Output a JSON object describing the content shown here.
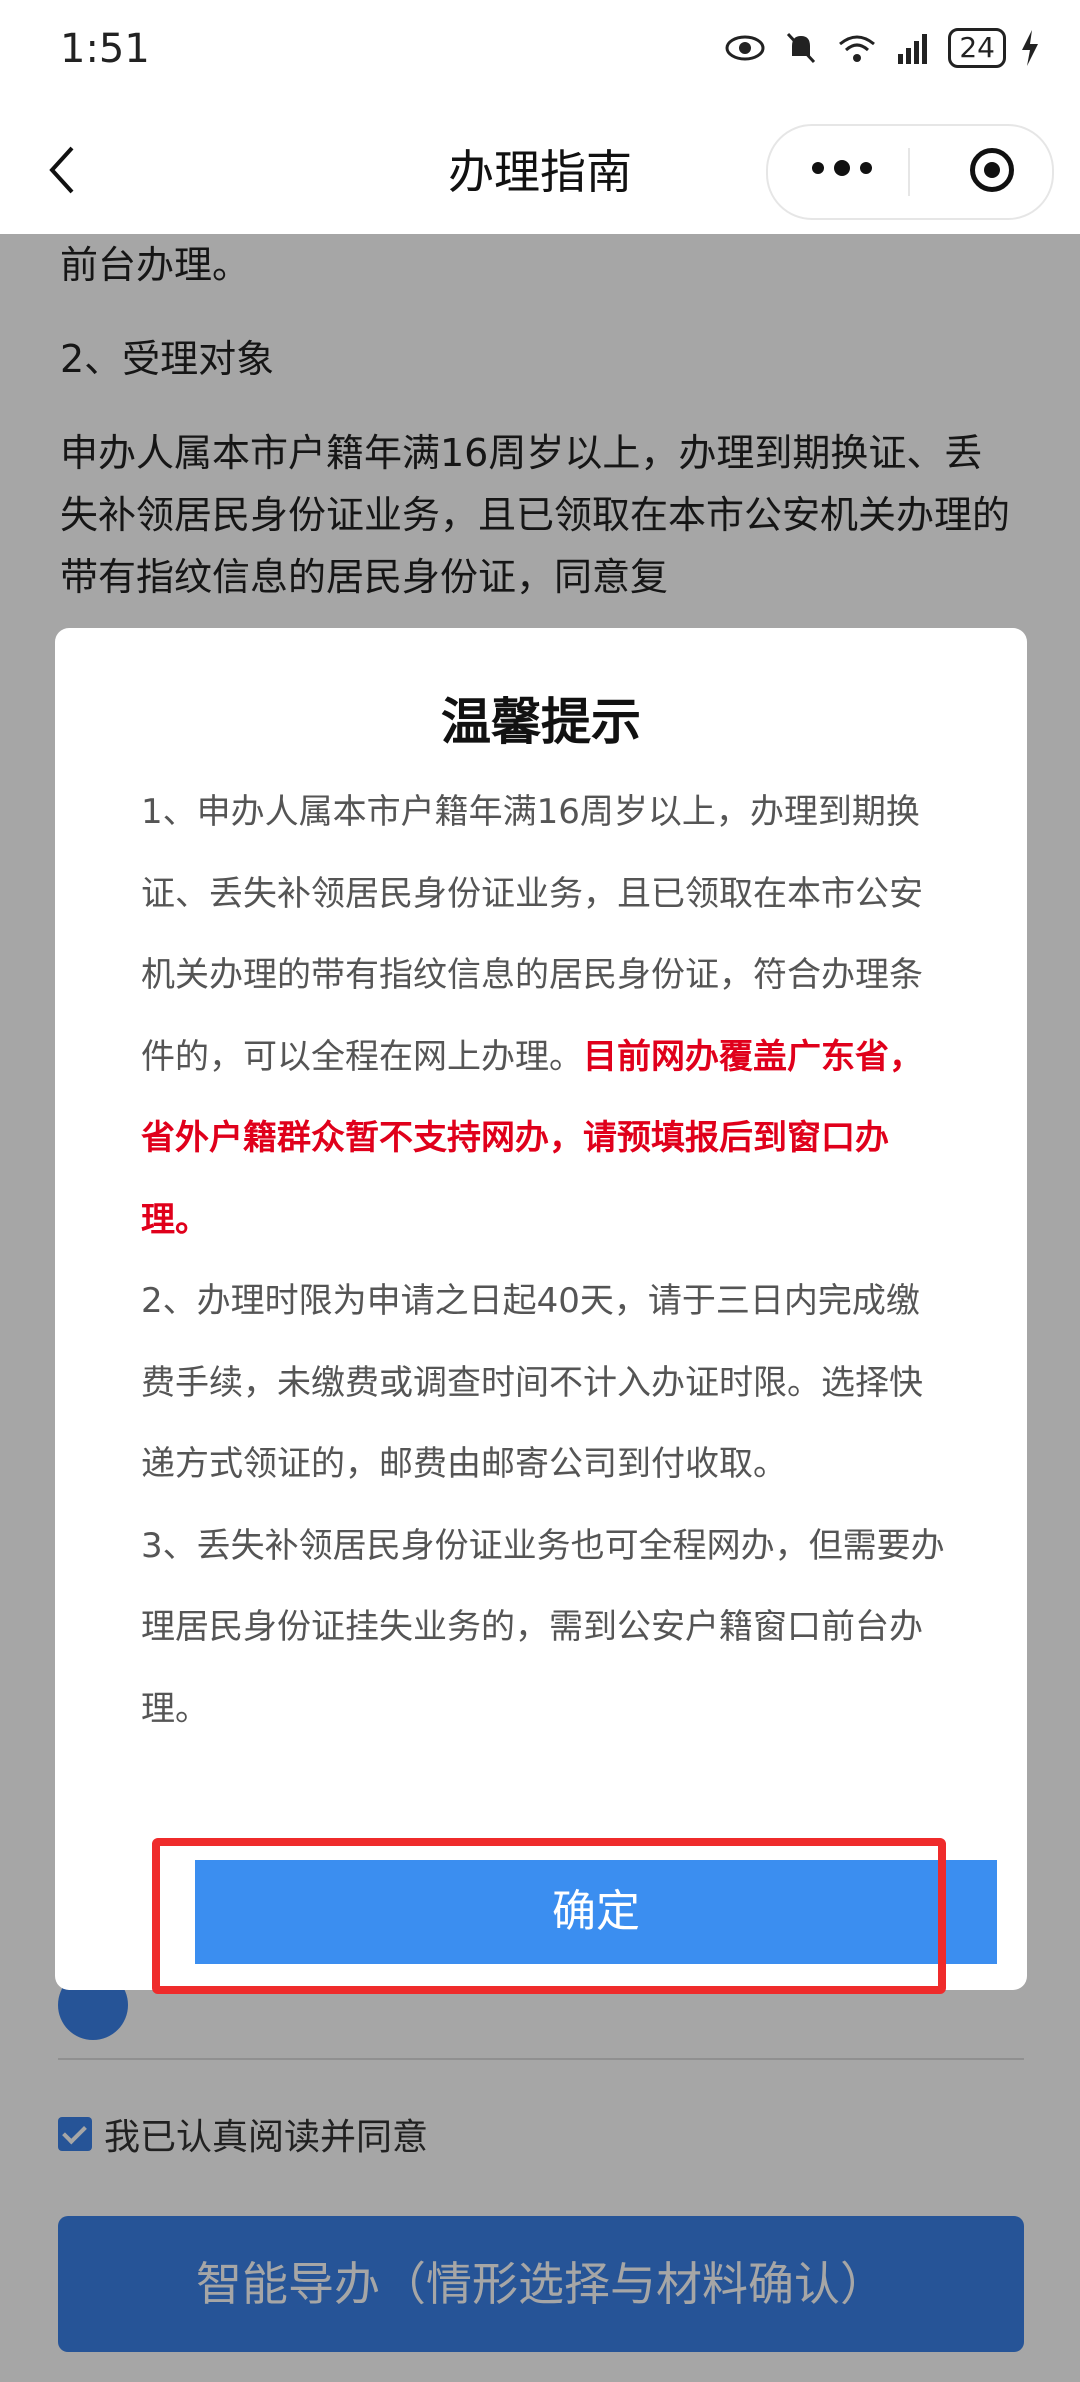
{
  "status_bar": {
    "time": "1:51",
    "battery": "24"
  },
  "nav": {
    "title": "办理指南"
  },
  "content": {
    "line_top": "前台办理。",
    "section2_title": "2、受理对象",
    "section2_body": "申办人属本市户籍年满16周岁以上，办理到期换证、丢失补领居民身份证业务，且已领取在本市公安机关办理的带有指纹信息的居民身份证，同意复"
  },
  "dialog": {
    "title": "温馨提示",
    "p1_normal": "1、申办人属本市户籍年满16周岁以上，办理到期换证、丢失补领居民身份证业务，且已领取在本市公安机关办理的带有指纹信息的居民身份证，符合办理条件的，可以全程在网上办理。",
    "p1_red": "目前网办覆盖广东省，省外户籍群众暂不支持网办，请预填报后到窗口办理。",
    "p2": "2、办理时限为申请之日起40天，请于三日内完成缴费手续，未缴费或调查时间不计入办证时限。选择快递方式领证的，邮费由邮寄公司到付收取。",
    "p3": "3、丢失补领居民身份证业务也可全程网办，但需要办理居民身份证挂失业务的，需到公安户籍窗口前台办理。",
    "confirm_label": "确定"
  },
  "footer": {
    "agree_label": "我已认真阅读并同意",
    "main_button_label": "智能导办（情形选择与材料确认）"
  },
  "colors": {
    "accent": "#3b82e8",
    "warning_red": "#e0001b",
    "highlight_border": "#ef2b2b"
  }
}
